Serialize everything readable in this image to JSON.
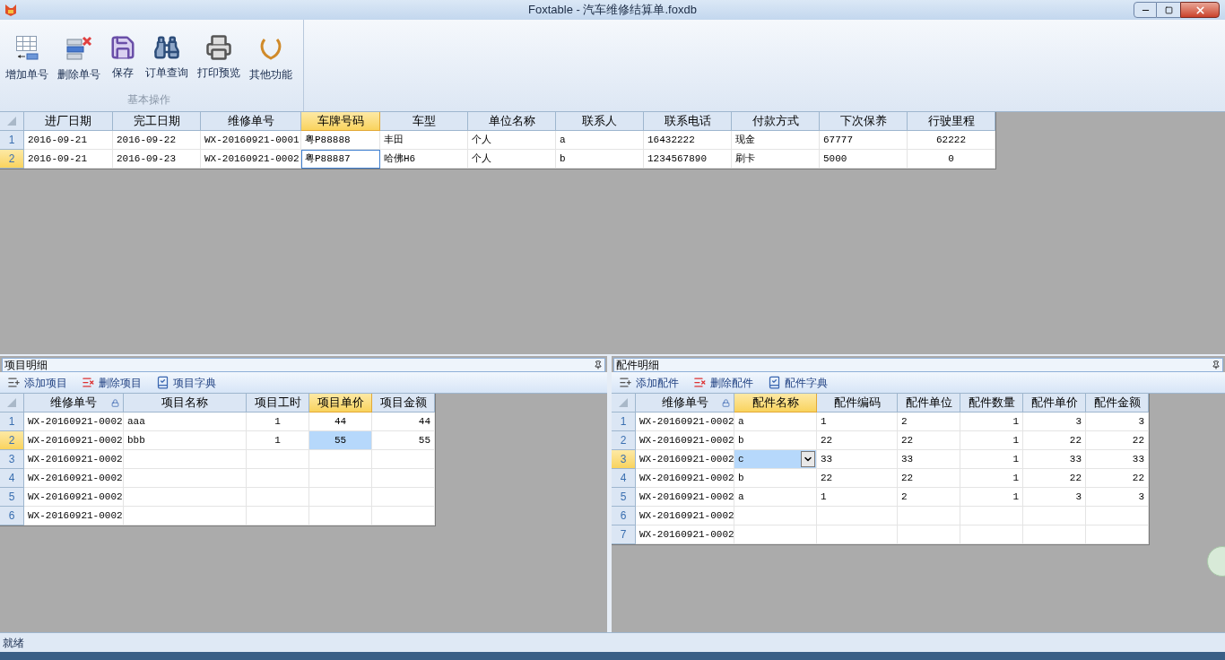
{
  "window": {
    "title": "Foxtable - 汽车维修结算单.foxdb"
  },
  "ribbon": {
    "buttons": [
      {
        "label": "增加单号",
        "kind": "add"
      },
      {
        "label": "删除单号",
        "kind": "delete"
      },
      {
        "label": "保存",
        "kind": "save"
      },
      {
        "label": "订单查询",
        "kind": "search"
      },
      {
        "label": "打印预览",
        "kind": "print"
      },
      {
        "label": "其他功能",
        "kind": "other"
      }
    ],
    "group_label": "基本操作"
  },
  "main_table": {
    "kind": "outline",
    "columns": [
      {
        "label": "进厂日期",
        "selected": false,
        "kind": "text",
        "locked": false
      },
      {
        "label": "完工日期",
        "selected": false,
        "kind": "text",
        "locked": false
      },
      {
        "label": "维修单号",
        "selected": false,
        "kind": "text",
        "locked": false
      },
      {
        "label": "车牌号码",
        "selected": true,
        "kind": "text",
        "locked": false
      },
      {
        "label": "车型",
        "selected": false,
        "kind": "text",
        "locked": false
      },
      {
        "label": "单位名称",
        "selected": false,
        "kind": "text",
        "locked": false
      },
      {
        "label": "联系人",
        "selected": false,
        "kind": "text",
        "locked": false
      },
      {
        "label": "联系电话",
        "selected": false,
        "kind": "text",
        "locked": false
      },
      {
        "label": "付款方式",
        "selected": false,
        "kind": "text",
        "locked": false
      },
      {
        "label": "下次保养",
        "selected": false,
        "kind": "text",
        "locked": false
      },
      {
        "label": "行驶里程",
        "selected": false,
        "kind": "centered",
        "locked": false
      }
    ],
    "rows": [
      {
        "number": "1",
        "selected": false,
        "cells": [
          "2016-09-21",
          "2016-09-22",
          "WX-20160921-0001",
          "粤P88888",
          "丰田",
          "个人",
          "a",
          "16432222",
          "现金",
          "67777",
          "62222"
        ]
      },
      {
        "number": "2",
        "selected": true,
        "cells": [
          "2016-09-21",
          "2016-09-23",
          "WX-20160921-0002",
          "粤P88887",
          "哈佛H6",
          "个人",
          "b",
          "1234567890",
          "刷卡",
          "5000",
          "0"
        ]
      }
    ]
  },
  "items_panel": {
    "title": "项目明细",
    "toolbar": [
      {
        "label": "添加项目",
        "kind": "add"
      },
      {
        "label": "删除项目",
        "kind": "delete"
      },
      {
        "label": "项目字典",
        "kind": "dictionary"
      }
    ],
    "table": {
      "kind": "fill",
      "columns": [
        {
          "label": "维修单号",
          "selected": false,
          "kind": "text",
          "locked": true
        },
        {
          "label": "项目名称",
          "selected": false,
          "kind": "text",
          "locked": false
        },
        {
          "label": "项目工时",
          "selected": false,
          "kind": "centered",
          "locked": false
        },
        {
          "label": "项目单价",
          "selected": true,
          "kind": "centered",
          "locked": false
        },
        {
          "label": "项目金额",
          "selected": false,
          "kind": "number",
          "locked": false
        }
      ],
      "rows": [
        {
          "number": "1",
          "selected": false,
          "cells": [
            "WX-20160921-0002",
            "aaa",
            "1",
            "44",
            "44"
          ]
        },
        {
          "number": "2",
          "selected": true,
          "cells": [
            "WX-20160921-0002",
            "bbb",
            "1",
            "55",
            "55"
          ]
        },
        {
          "number": "3",
          "selected": false,
          "cells": [
            "WX-20160921-0002"
          ]
        },
        {
          "number": "4",
          "selected": false,
          "cells": [
            "WX-20160921-0002"
          ]
        },
        {
          "number": "5",
          "selected": false,
          "cells": [
            "WX-20160921-0002"
          ]
        },
        {
          "number": "6",
          "selected": false,
          "cells": [
            "WX-20160921-0002"
          ]
        }
      ]
    }
  },
  "parts_panel": {
    "title": "配件明细",
    "toolbar": [
      {
        "label": "添加配件",
        "kind": "add"
      },
      {
        "label": "删除配件",
        "kind": "delete"
      },
      {
        "label": "配件字典",
        "kind": "dictionary"
      }
    ],
    "table": {
      "kind": "dropdown",
      "columns": [
        {
          "label": "维修单号",
          "selected": false,
          "kind": "text",
          "locked": true
        },
        {
          "label": "配件名称",
          "selected": true,
          "kind": "text",
          "locked": false
        },
        {
          "label": "配件编码",
          "selected": false,
          "kind": "text",
          "locked": false
        },
        {
          "label": "配件单位",
          "selected": false,
          "kind": "text",
          "locked": false
        },
        {
          "label": "配件数量",
          "selected": false,
          "kind": "number",
          "locked": false
        },
        {
          "label": "配件单价",
          "selected": false,
          "kind": "number",
          "locked": false
        },
        {
          "label": "配件金额",
          "selected": false,
          "kind": "number",
          "locked": false
        }
      ],
      "rows": [
        {
          "number": "1",
          "selected": false,
          "cells": [
            "WX-20160921-0002",
            "a",
            "1",
            "2",
            "1",
            "3",
            "3"
          ]
        },
        {
          "number": "2",
          "selected": false,
          "cells": [
            "WX-20160921-0002",
            "b",
            "22",
            "22",
            "1",
            "22",
            "22"
          ]
        },
        {
          "number": "3",
          "selected": true,
          "cells": [
            "WX-20160921-0002",
            "c",
            "33",
            "33",
            "1",
            "33",
            "33"
          ]
        },
        {
          "number": "4",
          "selected": false,
          "cells": [
            "WX-20160921-0002",
            "b",
            "22",
            "22",
            "1",
            "22",
            "22"
          ]
        },
        {
          "number": "5",
          "selected": false,
          "cells": [
            "WX-20160921-0002",
            "a",
            "1",
            "2",
            "1",
            "3",
            "3"
          ]
        },
        {
          "number": "6",
          "selected": false,
          "cells": [
            "WX-20160921-0002"
          ]
        },
        {
          "number": "7",
          "selected": false,
          "cells": [
            "WX-20160921-0002"
          ]
        }
      ]
    }
  },
  "status_bar": {
    "text": "就绪"
  }
}
